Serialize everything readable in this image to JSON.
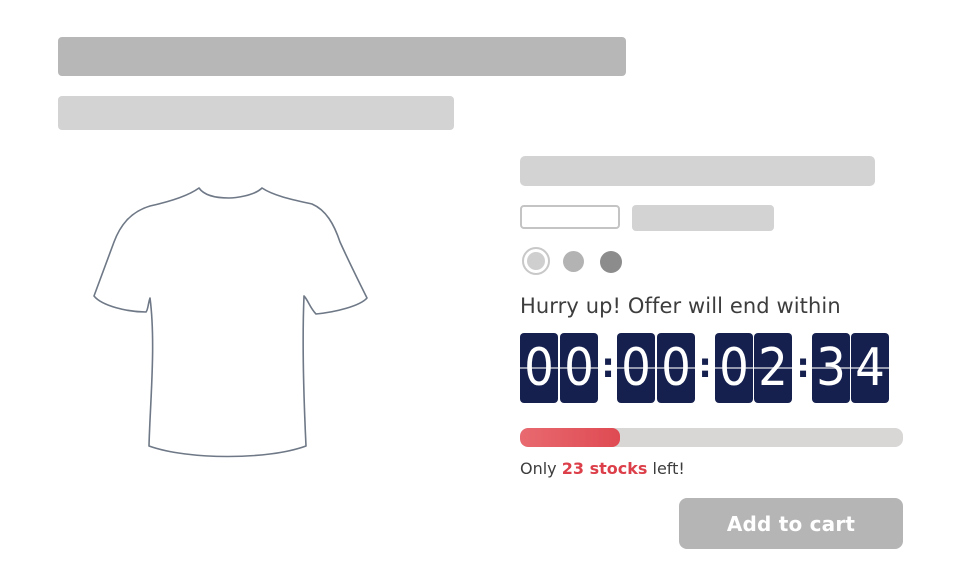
{
  "product": {
    "image_icon": "tshirt-outline-icon",
    "color_swatches": [
      {
        "name": "light-gray",
        "color": "#cfcfcf",
        "selected": true
      },
      {
        "name": "gray",
        "color": "#b3b3b3",
        "selected": false
      },
      {
        "name": "dark-gray",
        "color": "#8c8c8c",
        "selected": false
      }
    ]
  },
  "offer": {
    "text": "Hurry up! Offer will end within",
    "countdown": {
      "days": [
        "0",
        "0"
      ],
      "hours": [
        "0",
        "0"
      ],
      "minutes": [
        "0",
        "2"
      ],
      "seconds": [
        "3",
        "4"
      ],
      "separator": ":"
    },
    "accent_color": "#15204e"
  },
  "stock": {
    "progress_fraction": 0.26,
    "prefix": "Only",
    "count_text": "23 stocks",
    "suffix": "left!",
    "bar_color": "#df4a52"
  },
  "cart": {
    "button_label": "Add to cart"
  }
}
